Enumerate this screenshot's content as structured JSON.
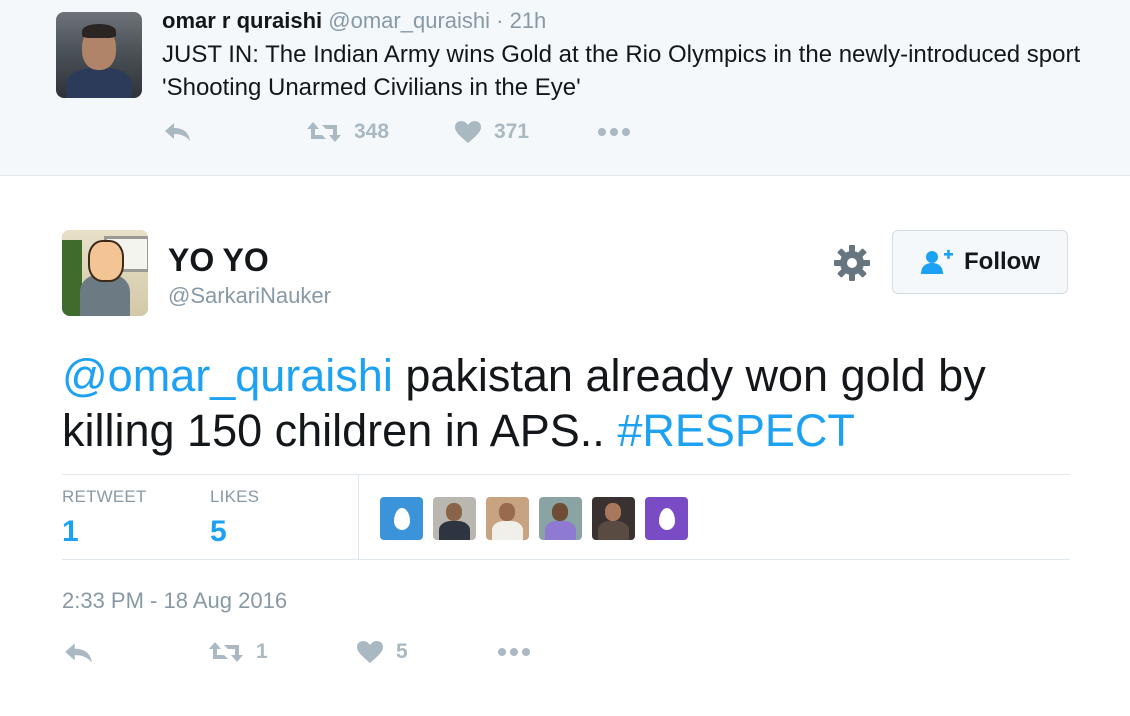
{
  "parent_tweet": {
    "name": "omar r quraishi",
    "handle": "@omar_quraishi",
    "time": "· 21h",
    "text": "JUST IN: The Indian Army wins Gold at the Rio Olympics in the newly-introduced sport 'Shooting Unarmed Civilians in the Eye'",
    "retweets": "348",
    "likes": "371",
    "icons": {
      "reply": "reply-icon",
      "retweet": "retweet-icon",
      "like": "heart-icon",
      "more": "more-icon"
    }
  },
  "tweet": {
    "name": "YO YO",
    "handle": "@SarkariNauker",
    "follow_label": "Follow",
    "text_parts": {
      "mention": "@omar_quraishi",
      "body": " pakistan already won gold by killing 150 children in APS.. ",
      "hashtag": "#RESPECT"
    },
    "stats": {
      "retweet_label": "RETWEET",
      "retweet_count": "1",
      "likes_label": "LIKES",
      "likes_count": "5"
    },
    "likers": [
      {
        "type": "egg",
        "color": "#3b94d9"
      },
      {
        "type": "photo"
      },
      {
        "type": "photo"
      },
      {
        "type": "photo"
      },
      {
        "type": "photo"
      },
      {
        "type": "egg",
        "color": "#794bc4"
      }
    ],
    "timestamp": "2:33 PM - 18 Aug 2016",
    "action_retweets": "1",
    "action_likes": "5"
  },
  "colors": {
    "link": "#1da1f2",
    "muted": "#8899a6",
    "icon": "#aab8c2",
    "follow_icon": "#1da1f2"
  }
}
